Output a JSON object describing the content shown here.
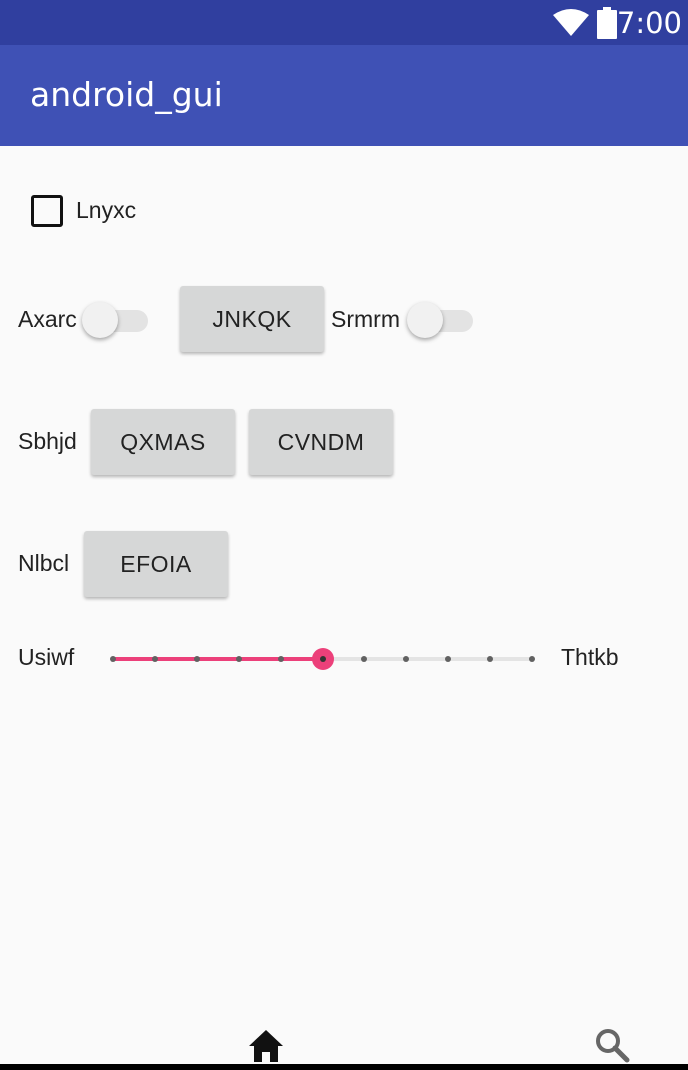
{
  "status_bar": {
    "time": "7:00",
    "wifi_icon": "wifi-icon",
    "battery_icon": "battery-icon"
  },
  "app_bar": {
    "title": "android_gui"
  },
  "checkbox": {
    "label": "Lnyxc",
    "checked": false
  },
  "row1": {
    "switch1": {
      "label": "Axarc",
      "on": false
    },
    "button": {
      "label": "JNKQK"
    },
    "switch2": {
      "label": "Srmrm",
      "on": false
    }
  },
  "row2": {
    "label": "Sbhjd",
    "buttons": [
      {
        "label": "QXMAS"
      },
      {
        "label": "CVNDM"
      }
    ]
  },
  "row3": {
    "label": "Nlbcl",
    "button": {
      "label": "EFOIA"
    }
  },
  "slider": {
    "min_label": "Usiwf",
    "max_label": "Thtkb",
    "steps": 10,
    "value": 5,
    "accent_color": "#ec407a"
  },
  "bottom_nav": {
    "items": [
      {
        "icon": "home-icon"
      },
      {
        "icon": "search-icon"
      }
    ]
  },
  "colors": {
    "status_bar": "#303f9f",
    "app_bar": "#3f51b5",
    "background": "#fafafa",
    "button": "#d6d7d7"
  }
}
